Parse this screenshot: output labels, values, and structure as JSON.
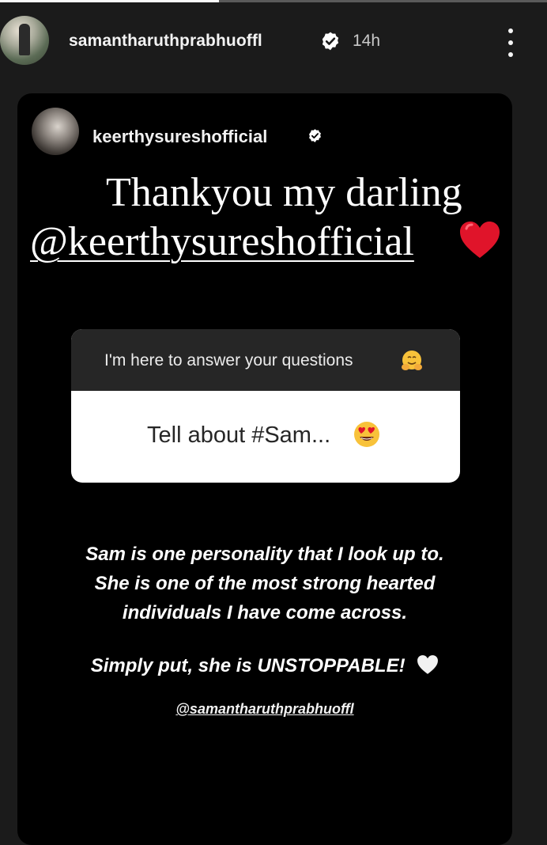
{
  "story": {
    "progress_fraction": 0.4,
    "author": "samantharuthprabhuoffl",
    "time_ago": "14h"
  },
  "shared_post": {
    "author": "keerthysureshofficial",
    "caption_line1": "Thankyou my darling",
    "caption_mention": "@keerthysureshofficial",
    "question_prompt": "I'm here to answer your questions",
    "question_answer": "Tell about #Sam...",
    "reply_lines": [
      "Sam is one personality that I look up to.",
      "She is one of the most strong hearted",
      "individuals I have come across."
    ],
    "reply_closing": "Simply put, she is UNSTOPPABLE!",
    "bottom_mention": "@samantharuthprabhuoffl"
  },
  "icons": {
    "verified": "verified-badge-icon",
    "more": "more-vertical-icon",
    "heart_red": "red-heart-icon",
    "heart_white": "white-heart-icon",
    "hug": "hugging-face-icon",
    "heart_eyes": "heart-eyes-icon"
  },
  "colors": {
    "background": "#1b1b1b",
    "card": "#000000",
    "question_header": "#262626",
    "heart_red": "#e0142a"
  }
}
